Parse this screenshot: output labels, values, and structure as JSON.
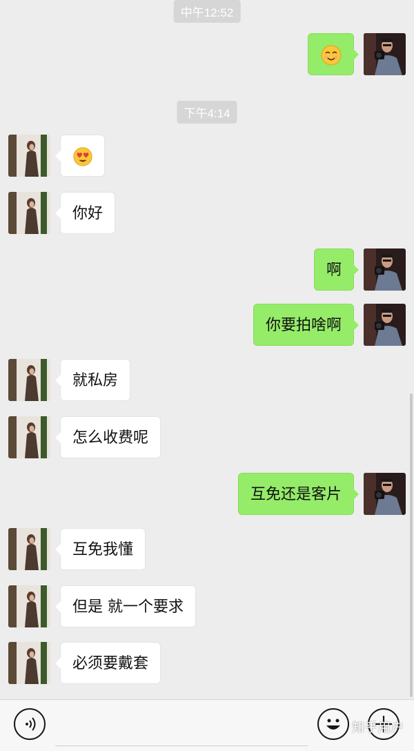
{
  "timestamps": [
    "中午12:52",
    "下午4:14"
  ],
  "messages": [
    {
      "side": "right",
      "emoji": "smiling-face-icon"
    },
    {
      "side": "left",
      "emoji": "heart-eyes-face-icon"
    },
    {
      "side": "left",
      "text": "你好"
    },
    {
      "side": "right",
      "text": "啊"
    },
    {
      "side": "right",
      "text": "你要拍啥啊"
    },
    {
      "side": "left",
      "text": "就私房"
    },
    {
      "side": "left",
      "text": "怎么收费呢"
    },
    {
      "side": "right",
      "text": "互免还是客片"
    },
    {
      "side": "left",
      "text": "互免我懂"
    },
    {
      "side": "left",
      "text": "但是 就一个要求"
    },
    {
      "side": "left",
      "text": "必须要戴套"
    }
  ],
  "colors": {
    "background": "#ededed",
    "sent_bubble": "#95ec69",
    "received_bubble": "#ffffff",
    "input_bar": "#f7f7f7"
  },
  "input_bar": {
    "voice_icon": "voice-icon",
    "emoji_icon": "emoji-face-icon",
    "more_icon": "plus-icon"
  },
  "watermark": "知乎用户"
}
